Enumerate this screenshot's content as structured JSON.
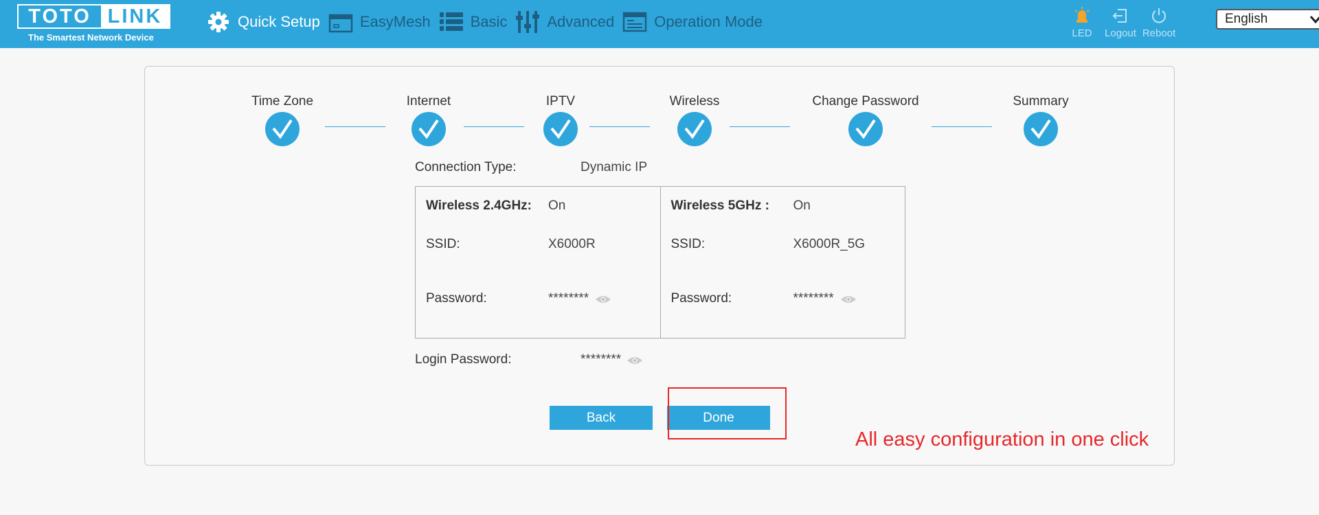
{
  "brand": {
    "logo_left": "TOTO",
    "logo_right": "LINK",
    "tagline": "The Smartest Network Device"
  },
  "nav": [
    {
      "label": "Quick Setup",
      "icon": "gear-icon",
      "active": true
    },
    {
      "label": "EasyMesh",
      "icon": "router-icon",
      "active": false
    },
    {
      "label": "Basic",
      "icon": "list-icon",
      "active": false
    },
    {
      "label": "Advanced",
      "icon": "sliders-icon",
      "active": false
    },
    {
      "label": "Operation Mode",
      "icon": "window-icon",
      "active": false
    }
  ],
  "actions": [
    {
      "label": "LED",
      "icon": "led-icon"
    },
    {
      "label": "Logout",
      "icon": "logout-icon"
    },
    {
      "label": "Reboot",
      "icon": "power-icon"
    }
  ],
  "language": {
    "selected": "English"
  },
  "steps": [
    "Time Zone",
    "Internet",
    "IPTV",
    "Wireless",
    "Change Password",
    "Summary"
  ],
  "connection": {
    "label": "Connection Type:",
    "value": "Dynamic IP"
  },
  "wireless_24": {
    "title": "Wireless 2.4GHz:",
    "status": "On",
    "ssid_label": "SSID:",
    "ssid": "X6000R",
    "password_label": "Password:",
    "password": "********"
  },
  "wireless_5": {
    "title": "Wireless 5GHz :",
    "status": "On",
    "ssid_label": "SSID:",
    "ssid": "X6000R_5G",
    "password_label": "Password:",
    "password": "********"
  },
  "login": {
    "label": "Login Password:",
    "value": "********"
  },
  "buttons": {
    "back": "Back",
    "done": "Done"
  },
  "annotation": "All easy configuration in one click",
  "colors": {
    "accent": "#2ea6dc",
    "annotation": "#e8262a"
  }
}
